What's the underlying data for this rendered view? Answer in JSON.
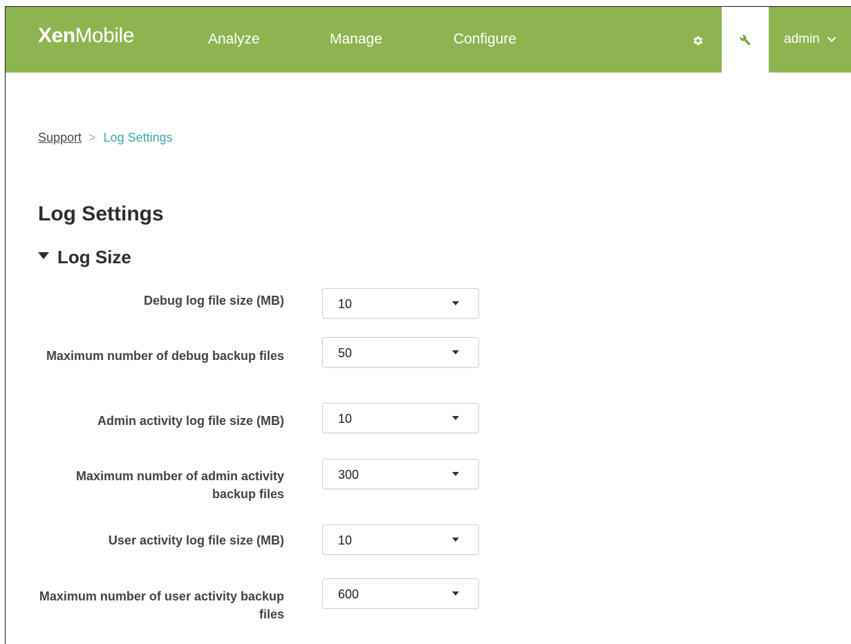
{
  "header": {
    "logo_bold": "Xen",
    "logo_light": "Mobile",
    "nav": {
      "analyze": "Analyze",
      "manage": "Manage",
      "configure": "Configure"
    },
    "user_menu_label": "admin"
  },
  "breadcrumb": {
    "parent": "Support",
    "separator": ">",
    "current": "Log Settings"
  },
  "page_title": "Log Settings",
  "section": {
    "title": "Log Size",
    "expanded": true
  },
  "fields": [
    {
      "label": "Debug log file size (MB)",
      "value": "10"
    },
    {
      "label": "Maximum number of debug backup files",
      "value": "50"
    },
    {
      "label": "Admin activity log file size (MB)",
      "value": "10"
    },
    {
      "label": "Maximum number of admin activity backup files",
      "value": "300"
    },
    {
      "label": "User activity log file size (MB)",
      "value": "10"
    },
    {
      "label": "Maximum number of user activity backup files",
      "value": "600"
    }
  ],
  "colors": {
    "header_bg": "#8db451",
    "breadcrumb_current": "#3fa7ad",
    "text_dark": "#2e2e2e"
  },
  "icons": {
    "settings": "gear-icon",
    "support": "wrench-icon",
    "user_menu": "chevron-down-icon",
    "section_toggle": "triangle-down-icon",
    "select": "caret-down-icon"
  }
}
